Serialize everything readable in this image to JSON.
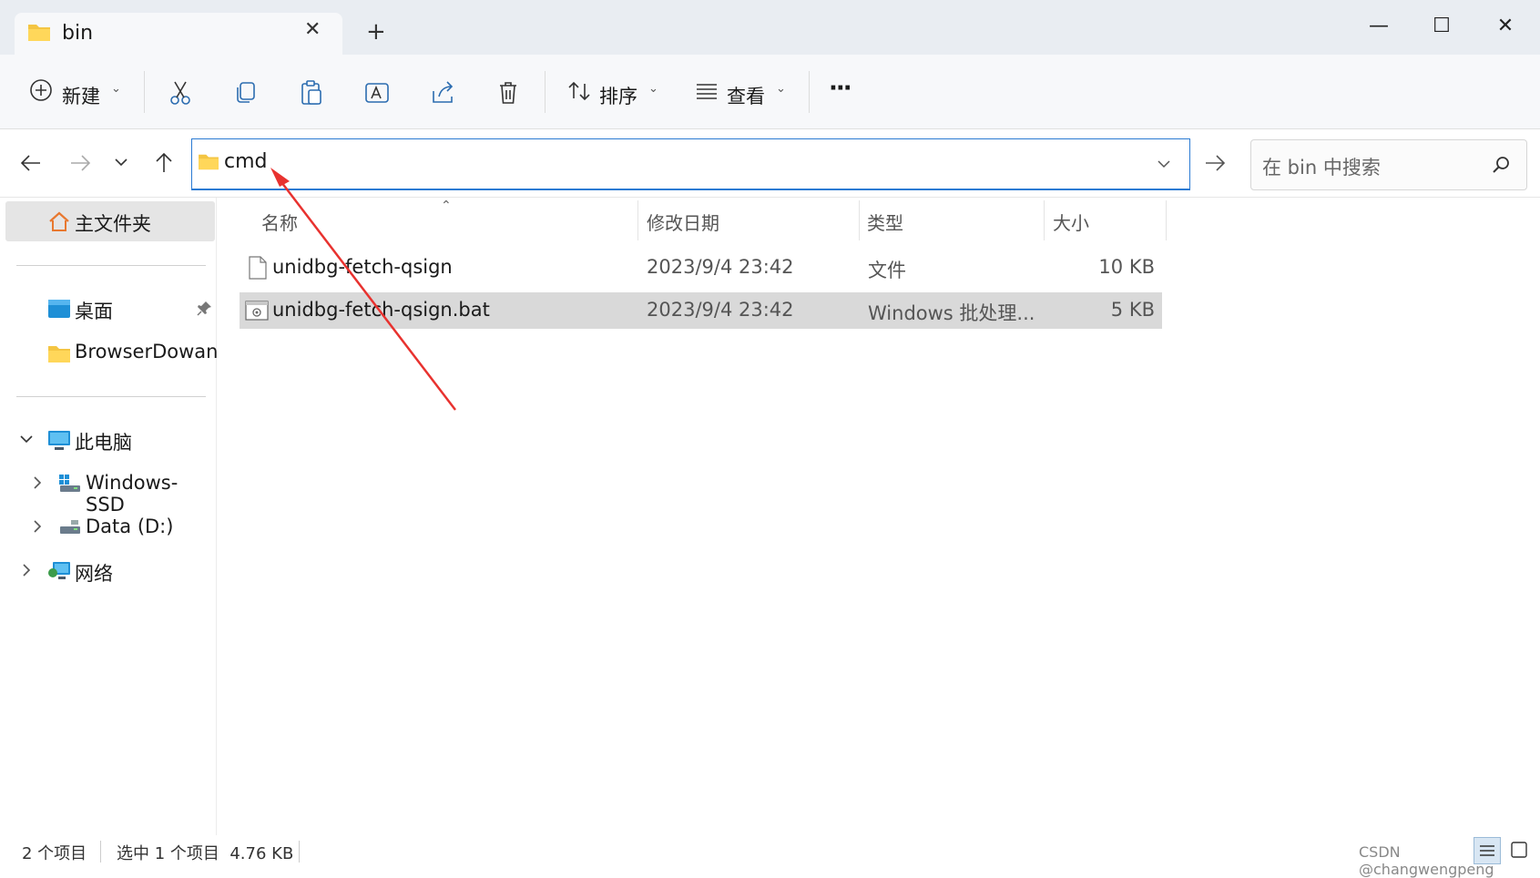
{
  "window": {
    "tab_title": "bin",
    "tab_close": "✕",
    "new_tab": "+",
    "minimize": "—",
    "maximize": "☐",
    "close": "✕"
  },
  "toolbar": {
    "new_label": "新建",
    "sort_label": "排序",
    "view_label": "查看",
    "more_label": "···"
  },
  "address": {
    "path": "cmd",
    "search_placeholder": "在 bin 中搜索"
  },
  "sidebar": {
    "home": "主文件夹",
    "desktop": "桌面",
    "browser_folder": "BrowserDowan",
    "this_pc": "此电脑",
    "drive_c": "Windows-SSD",
    "drive_d": "Data (D:)",
    "network": "网络"
  },
  "columns": {
    "name": "名称",
    "modified": "修改日期",
    "type": "类型",
    "size": "大小"
  },
  "files": [
    {
      "name": "unidbg-fetch-qsign",
      "modified": "2023/9/4 23:42",
      "type": "文件",
      "size": "10 KB"
    },
    {
      "name": "unidbg-fetch-qsign.bat",
      "modified": "2023/9/4 23:42",
      "type": "Windows 批处理...",
      "size": "5 KB"
    }
  ],
  "status": {
    "count": "2 个项目",
    "selection": "选中 1 个项目  4.76 KB",
    "watermark": "CSDN @changwengpeng"
  },
  "colors": {
    "accent": "#2b7bd3",
    "selection_bg": "#d9d9d9",
    "folder": "#f4c542",
    "annotation_arrow": "#e8322f"
  }
}
